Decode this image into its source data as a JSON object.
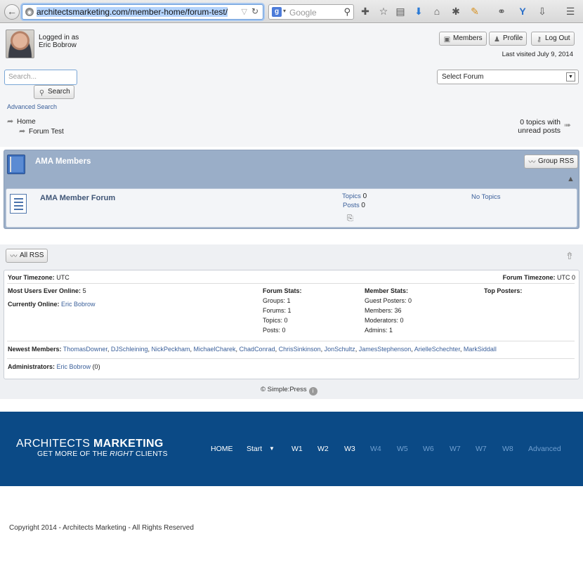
{
  "browser": {
    "url_host": "architectsmarketing.com",
    "url_path": "/member-home/forum-test/",
    "search_engine": "Google"
  },
  "user": {
    "logged_in_as": "Logged in as",
    "name": "Eric Bobrow"
  },
  "header": {
    "members_label": "Members",
    "profile_label": "Profile",
    "logout_label": "Log Out",
    "last_visited": "Last visited July 9, 2014"
  },
  "search": {
    "placeholder": "Search...",
    "button_label": "Search",
    "advanced_label": "Advanced Search"
  },
  "select_forum": {
    "selected": "Select Forum"
  },
  "breadcrumbs": {
    "home": "Home",
    "current": "Forum Test"
  },
  "unread": {
    "line1": "0 topics with",
    "line2": "unread posts"
  },
  "group": {
    "title": "AMA Members",
    "rss_label": "Group RSS",
    "forum": {
      "name": "AMA Member Forum",
      "topics_label": "Topics",
      "topics_count": "0",
      "posts_label": "Posts",
      "posts_count": "0",
      "last_post": "No Topics"
    }
  },
  "all_rss_label": "All RSS",
  "stats": {
    "your_tz_label": "Your Timezone:",
    "your_tz": "UTC",
    "forum_tz_label": "Forum Timezone:",
    "forum_tz": "UTC 0",
    "most_users_label": "Most Users Ever Online:",
    "most_users": "5",
    "currently_online_label": "Currently Online:",
    "currently_online": "Eric Bobrow",
    "forum_stats_label": "Forum Stats:",
    "groups": "Groups: 1",
    "forums": "Forums: 1",
    "topics": "Topics: 0",
    "posts": "Posts: 0",
    "member_stats_label": "Member Stats:",
    "guest_posters": "Guest Posters: 0",
    "members": "Members: 36",
    "moderators": "Moderators: 0",
    "admins": "Admins: 1",
    "top_posters_label": "Top Posters:",
    "newest_label": "Newest Members:",
    "newest_members": [
      "ThomasDowner",
      "DJSchleining",
      "NickPeckham",
      "MichaelCharek",
      "ChadConrad",
      "ChrisSinkinson",
      "JonSchultz",
      "JamesStephenson",
      "ArielleSchechter",
      "MarkSiddall"
    ],
    "administrators_label": "Administrators:",
    "administrator": "Eric Bobrow",
    "administrator_count": "(0)"
  },
  "powered_by": "© Simple:Press",
  "site": {
    "logo_light": "ARCHITECTS ",
    "logo_bold": "MARKETING",
    "tagline_a": "GET MORE OF THE ",
    "tagline_b": "RIGHT",
    "tagline_c": " CLIENTS",
    "nav": [
      "HOME",
      "Start",
      "W1",
      "W2",
      "W3",
      "W4",
      "W5",
      "W6",
      "W7",
      "W7",
      "W8",
      "Advanced"
    ],
    "copyright": "Copyright 2014 - Architects Marketing - All Rights Reserved"
  },
  "colors": {
    "footer_bg": "#0b4a86",
    "group_header": "#9aaec8",
    "link": "#3a5f9a"
  }
}
